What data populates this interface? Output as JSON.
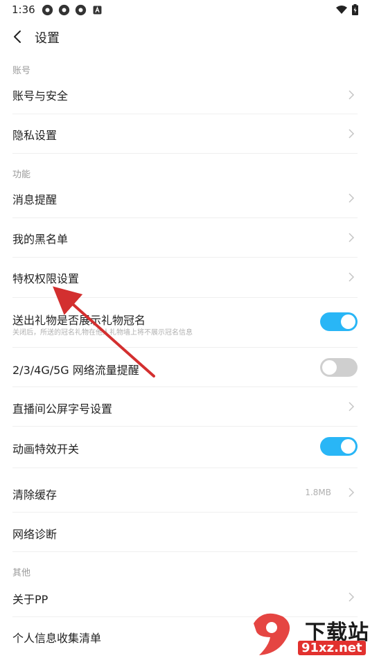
{
  "status": {
    "time": "1:36"
  },
  "header": {
    "title": "设置"
  },
  "sections": {
    "account": "账号",
    "features": "功能",
    "other": "其他"
  },
  "items": {
    "account_security": "账号与安全",
    "privacy": "隐私设置",
    "notifications": "消息提醒",
    "blacklist": "我的黑名单",
    "privilege": "特权权限设置",
    "gift_crown": "送出礼物是否展示礼物冠名",
    "gift_crown_sub": "关闭后，所送的冠名礼物在他人礼物墙上将不展示冠名信息",
    "traffic_alert": "2/3/4G/5G 网络流量提醒",
    "font_size": "直播间公屏字号设置",
    "animation": "动画特效开关",
    "clear_cache": "清除缓存",
    "cache_size": "1.8MB",
    "network_diag": "网络诊断",
    "about": "关于PP",
    "info_list": "个人信息收集清单"
  },
  "toggles": {
    "gift_crown": true,
    "traffic_alert": false,
    "animation": true
  },
  "colors": {
    "toggle_on": "#29b6f6",
    "toggle_off": "#cfcfcf",
    "arrow": "#d32f2f"
  },
  "watermark": {
    "text": "下载站",
    "url": "91xz.net"
  }
}
